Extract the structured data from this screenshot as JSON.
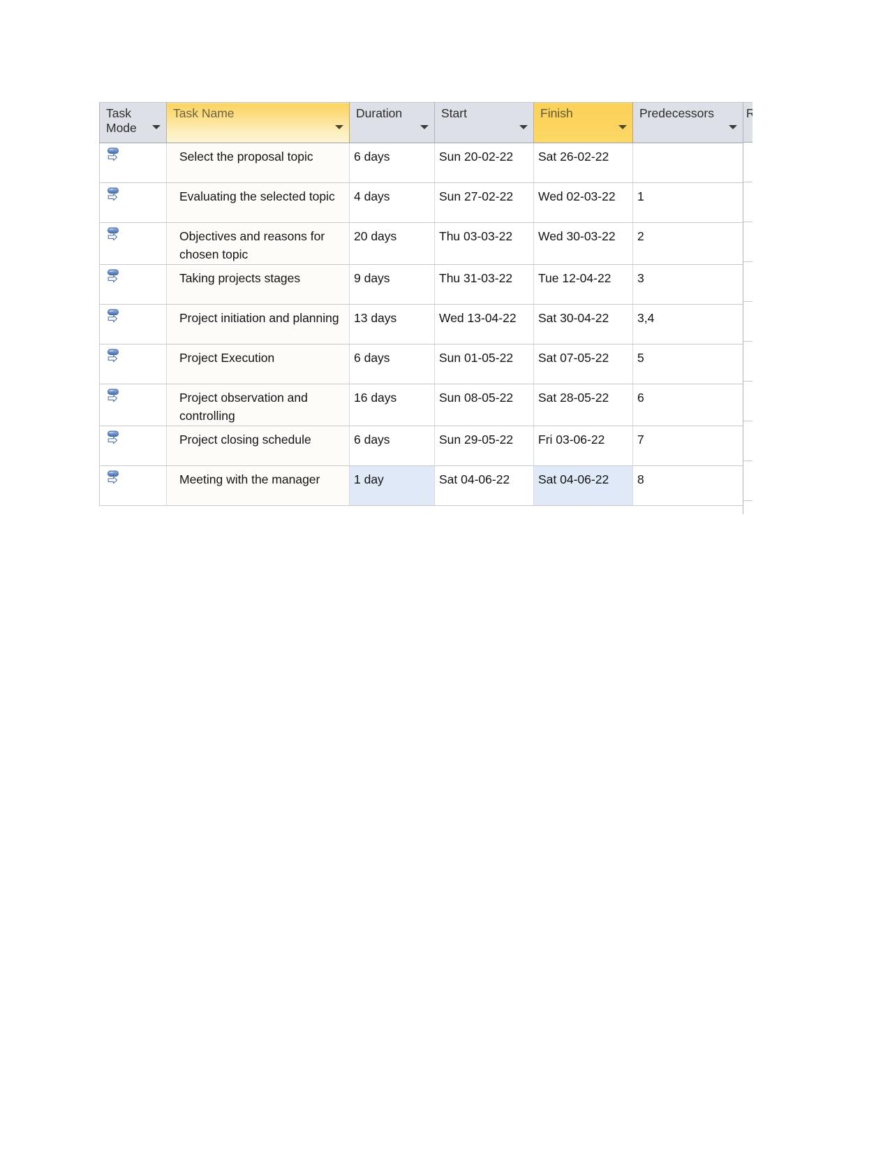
{
  "table": {
    "columns": [
      {
        "id": "task_mode",
        "label": "Task Mode",
        "style": "gray",
        "has_filter": true
      },
      {
        "id": "task_name",
        "label": "Task Name",
        "style": "amber-grad",
        "has_filter": true
      },
      {
        "id": "duration",
        "label": "Duration",
        "style": "gray",
        "has_filter": true
      },
      {
        "id": "start",
        "label": "Start",
        "style": "gray",
        "has_filter": true
      },
      {
        "id": "finish",
        "label": "Finish",
        "style": "amber-solid",
        "has_filter": true
      },
      {
        "id": "predecessors",
        "label": "Predecessors",
        "style": "gray",
        "has_filter": true
      }
    ],
    "clipped_column": {
      "label": "R"
    },
    "mode_icon_name": "auto-scheduled-icon",
    "rows": [
      {
        "mode_icon": "auto-scheduled-icon",
        "task_name": "Select the proposal topic",
        "duration": "6 days",
        "start": "Sun 20-02-22",
        "finish": "Sat 26-02-22",
        "predecessors": "",
        "selected": {
          "duration": false,
          "finish": false
        }
      },
      {
        "mode_icon": "auto-scheduled-icon",
        "task_name": "Evaluating the selected topic",
        "duration": "4 days",
        "start": "Sun 27-02-22",
        "finish": "Wed 02-03-22",
        "predecessors": "1",
        "selected": {
          "duration": false,
          "finish": false
        }
      },
      {
        "mode_icon": "auto-scheduled-icon",
        "task_name": "Objectives and reasons for chosen topic",
        "duration": "20 days",
        "start": "Thu 03-03-22",
        "finish": "Wed 30-03-22",
        "predecessors": "2",
        "selected": {
          "duration": false,
          "finish": false
        }
      },
      {
        "mode_icon": "auto-scheduled-icon",
        "task_name": "Taking projects stages",
        "duration": "9 days",
        "start": "Thu 31-03-22",
        "finish": "Tue 12-04-22",
        "predecessors": "3",
        "selected": {
          "duration": false,
          "finish": false
        }
      },
      {
        "mode_icon": "auto-scheduled-icon",
        "task_name": "Project initiation and planning",
        "duration": "13 days",
        "start": "Wed 13-04-22",
        "finish": "Sat 30-04-22",
        "predecessors": "3,4",
        "selected": {
          "duration": false,
          "finish": false
        }
      },
      {
        "mode_icon": "auto-scheduled-icon",
        "task_name": "Project Execution",
        "duration": "6 days",
        "start": "Sun 01-05-22",
        "finish": "Sat 07-05-22",
        "predecessors": "5",
        "selected": {
          "duration": false,
          "finish": false
        }
      },
      {
        "mode_icon": "auto-scheduled-icon",
        "task_name": "Project observation and controlling",
        "duration": "16 days",
        "start": "Sun 08-05-22",
        "finish": "Sat 28-05-22",
        "predecessors": "6",
        "selected": {
          "duration": false,
          "finish": false
        }
      },
      {
        "mode_icon": "auto-scheduled-icon",
        "task_name": "Project closing schedule",
        "duration": "6 days",
        "start": "Sun 29-05-22",
        "finish": "Fri 03-06-22",
        "predecessors": "7",
        "selected": {
          "duration": false,
          "finish": false
        }
      },
      {
        "mode_icon": "auto-scheduled-icon",
        "task_name": "Meeting with the manager",
        "duration": "1 day",
        "start": "Sat 04-06-22",
        "finish": "Sat 04-06-22",
        "predecessors": "8",
        "selected": {
          "duration": true,
          "finish": true
        }
      }
    ]
  },
  "colors": {
    "header_gray": "#dde1e7",
    "header_amber": "#fcd45e",
    "selection_blue": "#dfe9f7",
    "name_column_tint": "#fdfcf9",
    "grid_line": "#c6cacd",
    "icon_blue": "#5b7fc0"
  }
}
